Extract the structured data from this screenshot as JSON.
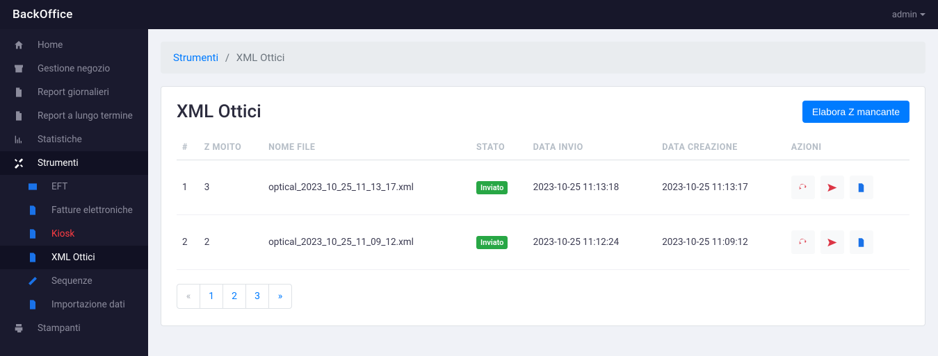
{
  "header": {
    "brand": "BackOffice",
    "user": "admin"
  },
  "sidebar": {
    "items": [
      {
        "label": "Home",
        "icon": "home"
      },
      {
        "label": "Gestione negozio",
        "icon": "store"
      },
      {
        "label": "Report giornalieri",
        "icon": "file"
      },
      {
        "label": "Report a lungo termine",
        "icon": "file"
      },
      {
        "label": "Statistiche",
        "icon": "chart"
      },
      {
        "label": "Strumenti",
        "icon": "tools",
        "active": true,
        "children": [
          {
            "label": "EFT",
            "icon": "card"
          },
          {
            "label": "Fatture elettroniche",
            "icon": "doc"
          },
          {
            "label": "Kiosk",
            "icon": "doc",
            "kiosk": true
          },
          {
            "label": "XML Ottici",
            "icon": "doc",
            "active": true
          },
          {
            "label": "Sequenze",
            "icon": "ruler"
          },
          {
            "label": "Importazione dati",
            "icon": "csv"
          }
        ]
      },
      {
        "label": "Stampanti",
        "icon": "print"
      }
    ]
  },
  "breadcrumb": {
    "parent": "Strumenti",
    "current": "XML Ottici"
  },
  "page": {
    "title": "XML Ottici",
    "primaryAction": "Elabora Z mancante"
  },
  "table": {
    "headers": {
      "index": "#",
      "zmoito": "Z MOITO",
      "filename": "NOME FILE",
      "status": "STATO",
      "sent": "DATA INVIO",
      "created": "DATA CREAZIONE",
      "actions": "AZIONI"
    },
    "statusLabel": "Inviato",
    "rows": [
      {
        "index": "1",
        "zmoito": "3",
        "filename": "optical_2023_10_25_11_13_17.xml",
        "sent": "2023-10-25 11:13:18",
        "created": "2023-10-25 11:13:17"
      },
      {
        "index": "2",
        "zmoito": "2",
        "filename": "optical_2023_10_25_11_09_12.xml",
        "sent": "2023-10-25 11:12:24",
        "created": "2023-10-25 11:09:12"
      }
    ]
  },
  "pagination": {
    "prev": "«",
    "pages": [
      "1",
      "2",
      "3"
    ],
    "next": "»"
  }
}
